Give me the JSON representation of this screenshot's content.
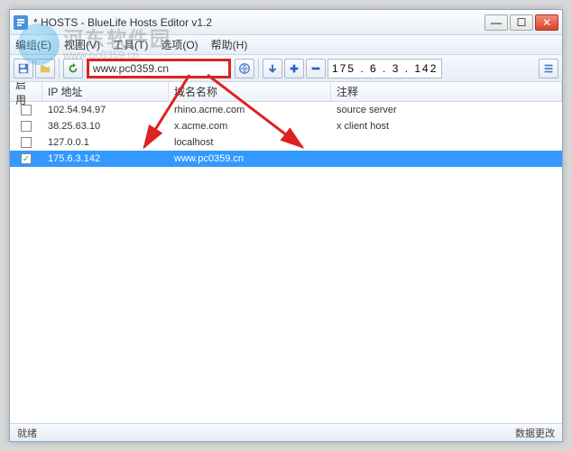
{
  "window": {
    "title": "* HOSTS - BlueLife Hosts Editor v1.2",
    "buttons": {
      "min": "—",
      "max": "☐",
      "close": "✕"
    }
  },
  "menu": {
    "file": "编组(E)",
    "view": "视图(V)",
    "tools": "工具(T)",
    "options": "选项(O)",
    "help": "帮助(H)"
  },
  "toolbar": {
    "domain_input": "www.pc0359.cn",
    "ip_input": "175 . 6 . 3 . 142"
  },
  "columns": {
    "enable": "启用",
    "ip": "IP 地址",
    "domain": "域名名称",
    "comment": "注释"
  },
  "rows": [
    {
      "checked": false,
      "ip": "102.54.94.97",
      "domain": "rhino.acme.com",
      "comment": "source server"
    },
    {
      "checked": false,
      "ip": "38.25.63.10",
      "domain": "x.acme.com",
      "comment": "x client host"
    },
    {
      "checked": false,
      "ip": "127.0.0.1",
      "domain": "localhost",
      "comment": ""
    },
    {
      "checked": true,
      "ip": "175.6.3.142",
      "domain": "www.pc0359.cn",
      "comment": "",
      "selected": true
    }
  ],
  "status": {
    "left": "就绪",
    "right": "数据更改"
  },
  "watermark": {
    "text1": "河东软件园",
    "text2": "www.pc0359.cn"
  },
  "colors": {
    "selection": "#3399ff",
    "highlight_box": "#d22"
  }
}
